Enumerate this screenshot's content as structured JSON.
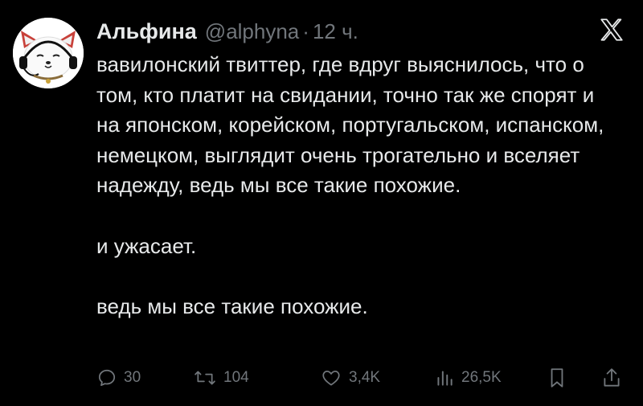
{
  "tweet": {
    "display_name": "Альфина",
    "handle": "@alphyna",
    "separator": "·",
    "time": "12 ч.",
    "paragraphs": [
      "вавилонский твиттер, где вдруг выяснилось, что о том, кто платит на свидании, точно так же спорят и на японском, корейском, португальском, испанском, немецком, выглядит очень трогательно и вселяет надежду, ведь мы все такие похожие.",
      "и ужасает.",
      "ведь мы все такие похожие."
    ]
  },
  "metrics": {
    "replies": "30",
    "retweets": "104",
    "likes": "3,4K",
    "views": "26,5K"
  },
  "icons": {
    "logo": "x-logo",
    "reply": "reply-icon",
    "retweet": "retweet-icon",
    "like": "heart-icon",
    "views": "views-icon",
    "bookmark": "bookmark-icon",
    "share": "share-icon"
  },
  "colors": {
    "background": "#000000",
    "text": "#e7e9ea",
    "secondary": "#71767b"
  }
}
